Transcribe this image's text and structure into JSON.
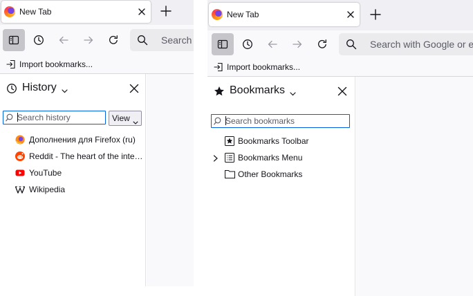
{
  "left_window": {
    "tab": {
      "title": "New Tab"
    },
    "urlbar": {
      "placeholder": "Search with Google or enter address"
    },
    "bookmarks_toolbar": {
      "import_label": "Import bookmarks..."
    },
    "sidebar": {
      "title": "History",
      "search_placeholder": "Search history",
      "view_button": "View",
      "items": [
        {
          "label": "Дополнения для Firefox (ru)",
          "icon": "firefox-icon"
        },
        {
          "label": "Reddit - The heart of the internet",
          "icon": "reddit-icon"
        },
        {
          "label": "YouTube",
          "icon": "youtube-icon"
        },
        {
          "label": "Wikipedia",
          "icon": "wikipedia-icon"
        }
      ]
    }
  },
  "right_window": {
    "tab": {
      "title": "New Tab"
    },
    "urlbar": {
      "placeholder": "Search with Google or enter address"
    },
    "bookmarks_toolbar": {
      "import_label": "Import bookmarks..."
    },
    "sidebar": {
      "title": "Bookmarks",
      "search_placeholder": "Search bookmarks",
      "items": [
        {
          "label": "Bookmarks Toolbar",
          "icon": "bookmarks-toolbar-icon"
        },
        {
          "label": "Bookmarks Menu",
          "icon": "bookmarks-menu-icon"
        },
        {
          "label": "Other Bookmarks",
          "icon": "folder-icon"
        }
      ]
    }
  },
  "colors": {
    "accent": "#0061e0",
    "tabstrip_bg": "#f0f0f4",
    "toolbar_bg": "#f9f9fb",
    "sidebar_button_active": "#c5c5ca"
  }
}
